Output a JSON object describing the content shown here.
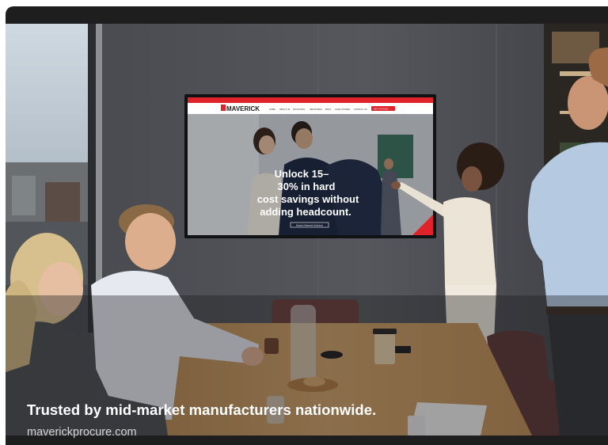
{
  "card": {
    "caption": "Trusted by mid-market manufacturers nationwide.",
    "domain": "maverickprocure.com"
  },
  "screen": {
    "brand": "MAVERICK",
    "nav_items": [
      "HOME",
      "ABOUT US",
      "SOLUTIONS",
      "INDUSTRIES",
      "BLOG",
      "CASE STUDIES",
      "CONTACT US"
    ],
    "nav_cta": "GET IN TOUCH",
    "hero_line_1": "Unlock 15–",
    "hero_line_2": "30% in hard",
    "hero_line_3": "cost savings without",
    "hero_line_4": "adding headcount.",
    "hero_button": "Explore Maverick Solutions"
  },
  "colors": {
    "brand_red": "#e0222b",
    "card_bg": "#1e1e1f",
    "table_wood": "#c99a5c",
    "wall": "#4a4c52"
  }
}
